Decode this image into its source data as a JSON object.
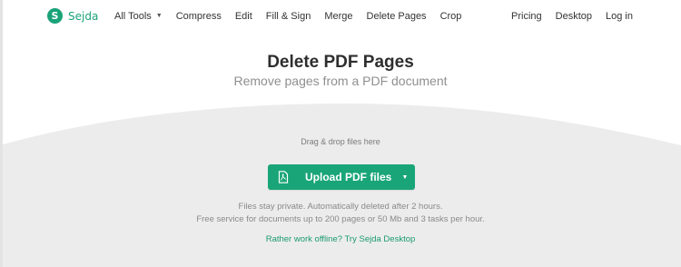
{
  "brand": {
    "name": "Sejda",
    "badge_letter": "S",
    "color": "#1aa278"
  },
  "nav": {
    "left": [
      {
        "label": "All Tools",
        "has_dropdown": true
      },
      {
        "label": "Compress"
      },
      {
        "label": "Edit"
      },
      {
        "label": "Fill & Sign"
      },
      {
        "label": "Merge"
      },
      {
        "label": "Delete Pages"
      },
      {
        "label": "Crop"
      }
    ],
    "right": [
      {
        "label": "Pricing"
      },
      {
        "label": "Desktop"
      },
      {
        "label": "Log in"
      }
    ]
  },
  "page": {
    "title": "Delete PDF Pages",
    "subtitle": "Remove pages from a PDF document"
  },
  "dropzone": {
    "hint": "Drag & drop files here",
    "upload_label": "Upload PDF files",
    "upload_icon": "pdf-file-icon",
    "dropdown_icon": "caret-down-icon",
    "accent_color": "#19a577",
    "info_line1": "Files stay private. Automatically deleted after 2 hours.",
    "info_line2": "Free service for documents up to 200 pages or 50 Mb and 3 tasks per hour.",
    "offline_link": "Rather work offline? Try Sejda Desktop"
  }
}
